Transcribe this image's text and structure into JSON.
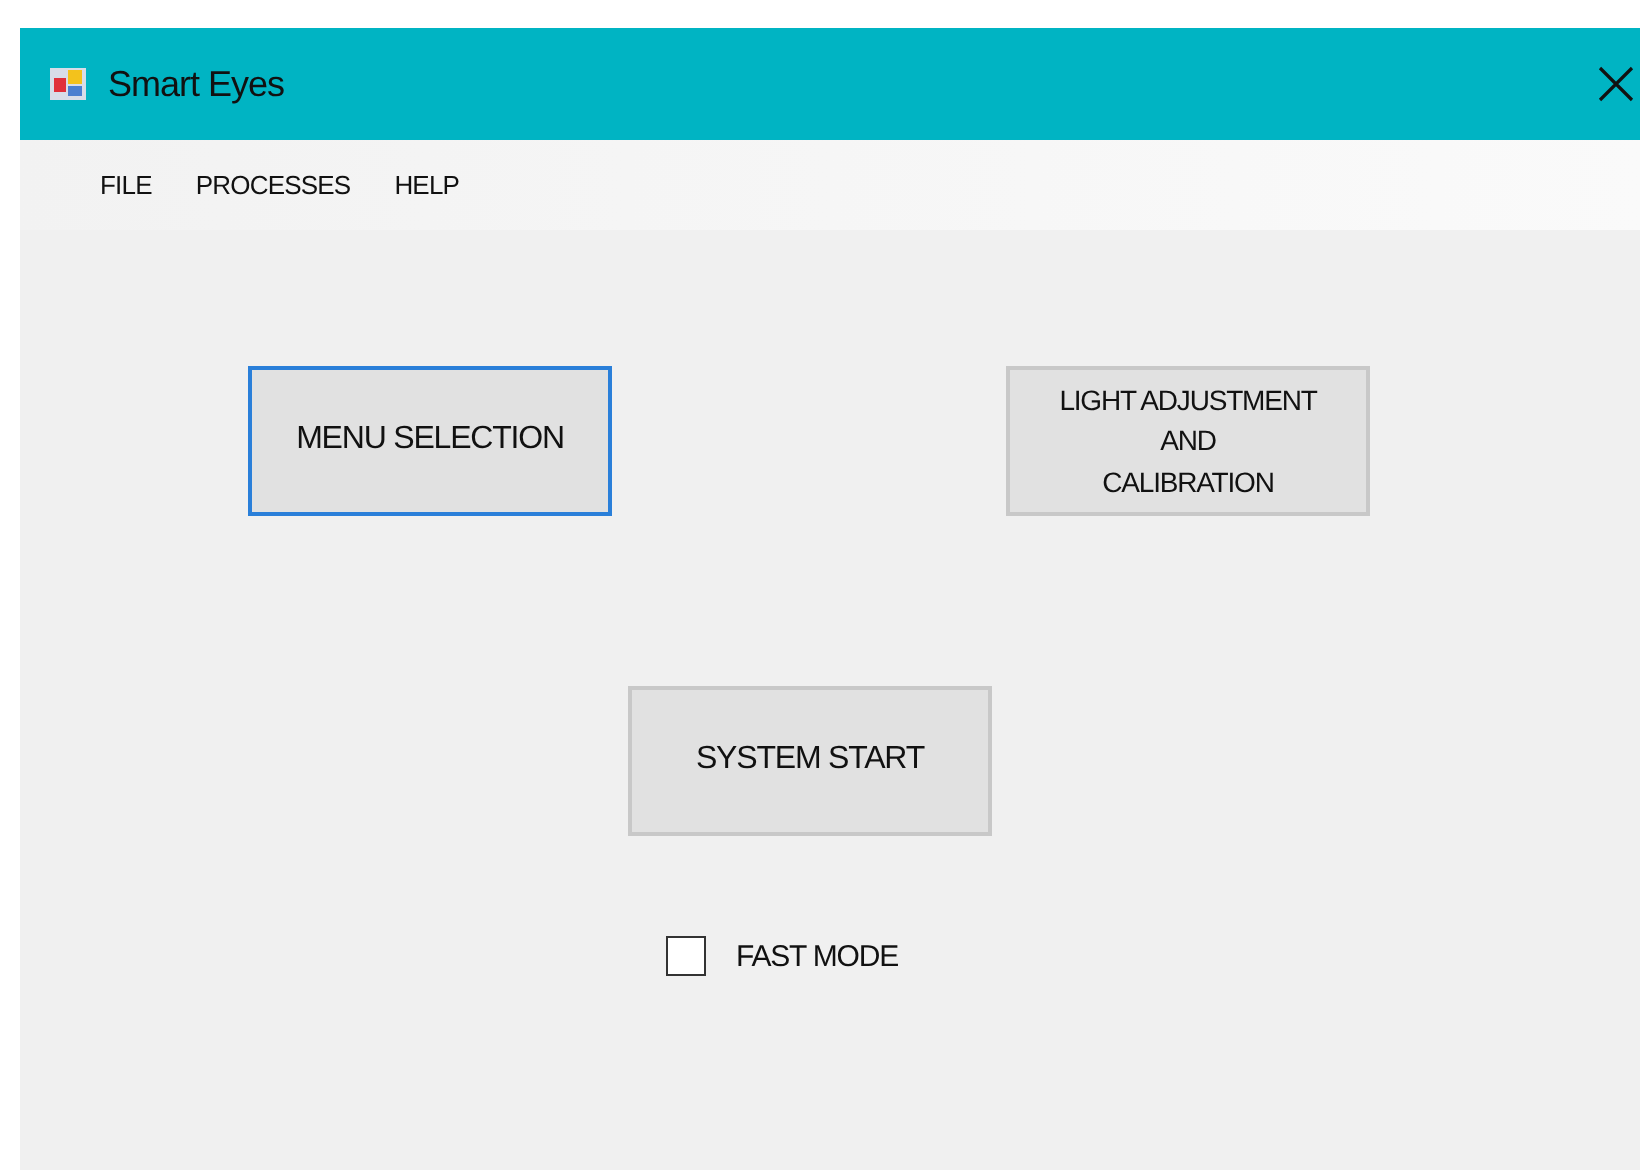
{
  "window": {
    "title": "Smart Eyes"
  },
  "menu": [
    {
      "label": "FILE"
    },
    {
      "label": "PROCESSES"
    },
    {
      "label": "HELP"
    }
  ],
  "buttons": [
    {
      "label": "MENU SELECTION",
      "focused": true
    },
    {
      "label": "LIGHT ADJUSTMENT\nAND\nCALIBRATION",
      "focused": false
    },
    {
      "label": "SYSTEM START",
      "focused": false
    }
  ],
  "checkbox": {
    "label": "FAST MODE",
    "checked": false
  }
}
